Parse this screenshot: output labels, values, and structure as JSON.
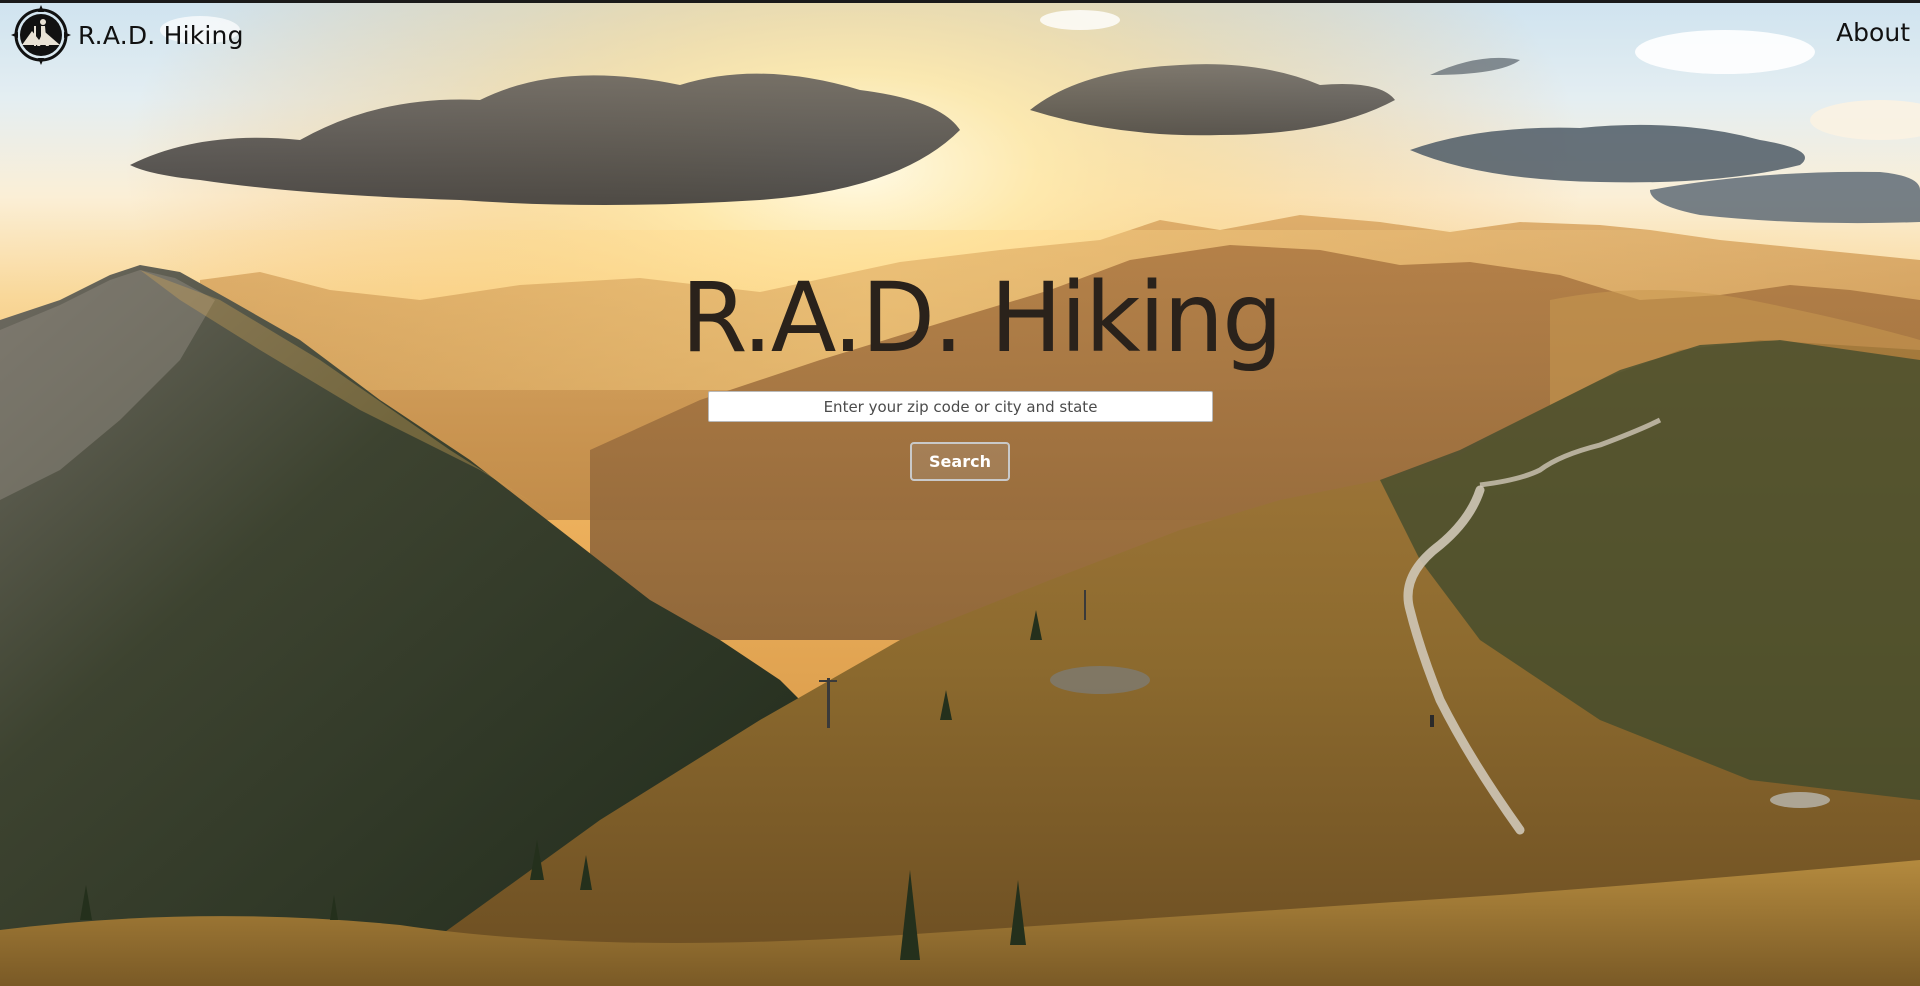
{
  "nav": {
    "brand_name": "R.A.D. Hiking",
    "logo_icon": "compass-hiker-icon",
    "about_label": "About"
  },
  "hero": {
    "title": "R.A.D. Hiking",
    "background": "sunset-mountain-trail-photo"
  },
  "search": {
    "placeholder": "Enter your zip code or city and state",
    "value": "",
    "button_label": "Search"
  },
  "colors": {
    "text_dark": "#111111",
    "title": "#2a221b",
    "button_text": "#ffffff"
  }
}
